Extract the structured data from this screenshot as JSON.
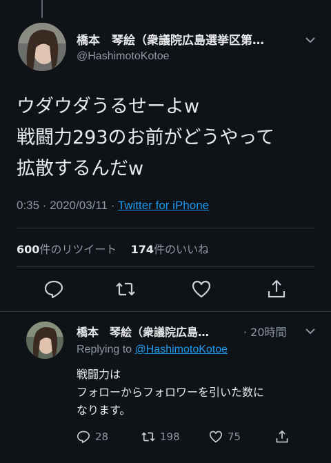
{
  "tweet": {
    "name": "橋本　琴絵（衆議院広島選挙区第…",
    "handle": "@HashimotoKotoe",
    "text_lines": [
      "ウダウダうるせーよw",
      "戦闘力293のお前がどうやって",
      "拡散するんだw"
    ],
    "time": "0:35 · 2020/03/11 · ",
    "source": "Twitter for iPhone",
    "retweets_count": "600",
    "retweets_label": "件のリツイート",
    "likes_count": "174",
    "likes_label": "件のいいね"
  },
  "reply": {
    "name": "橋本　琴絵（衆議院広島…",
    "time": "· 20時間",
    "replying_prefix": "Replying to ",
    "replying_to": "@HashimotoKotoe",
    "text_lines": [
      "戦闘力は",
      "フォローからフォロワーを引いた数に",
      "なります。"
    ],
    "reply_count": "28",
    "retweet_count": "198",
    "like_count": "75"
  },
  "icons": {
    "reply": "speech-bubble-icon",
    "retweet": "retweet-icon",
    "like": "heart-icon",
    "share": "share-icon",
    "more": "chevron-down-icon"
  },
  "colors": {
    "background": "#0f1216",
    "link": "#1d9bf0",
    "secondary_text": "#8b98a5"
  }
}
